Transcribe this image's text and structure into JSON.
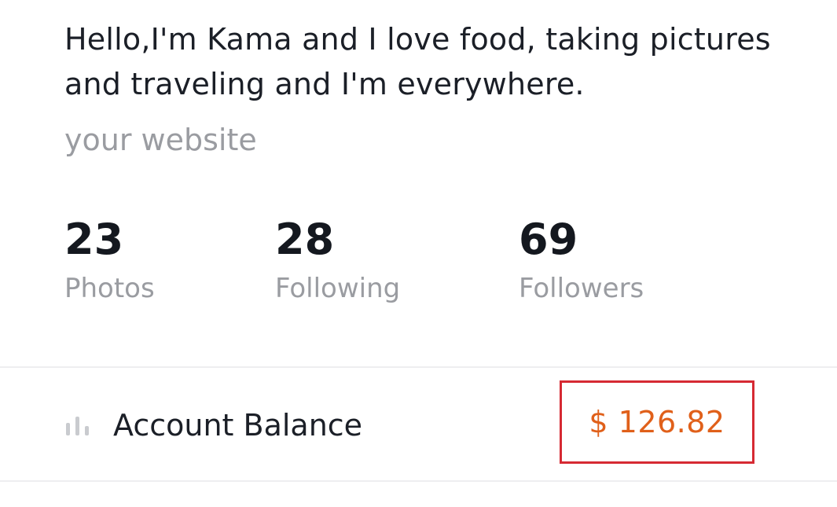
{
  "profile": {
    "bio": "Hello,I'm Kama and I love food, taking pictures and traveling and I'm everywhere.",
    "website": "your website"
  },
  "stats": [
    {
      "value": "23",
      "label": "Photos"
    },
    {
      "value": "28",
      "label": "Following"
    },
    {
      "value": "69",
      "label": "Followers"
    }
  ],
  "balance": {
    "icon": "bar-chart-icon",
    "label": "Account Balance",
    "value": "$ 126.82"
  },
  "colors": {
    "text_primary": "#1b1f27",
    "text_secondary": "#9a9ca1",
    "balance_value": "#e0601a",
    "highlight_border": "#d62a33",
    "divider": "#eeeef0"
  }
}
